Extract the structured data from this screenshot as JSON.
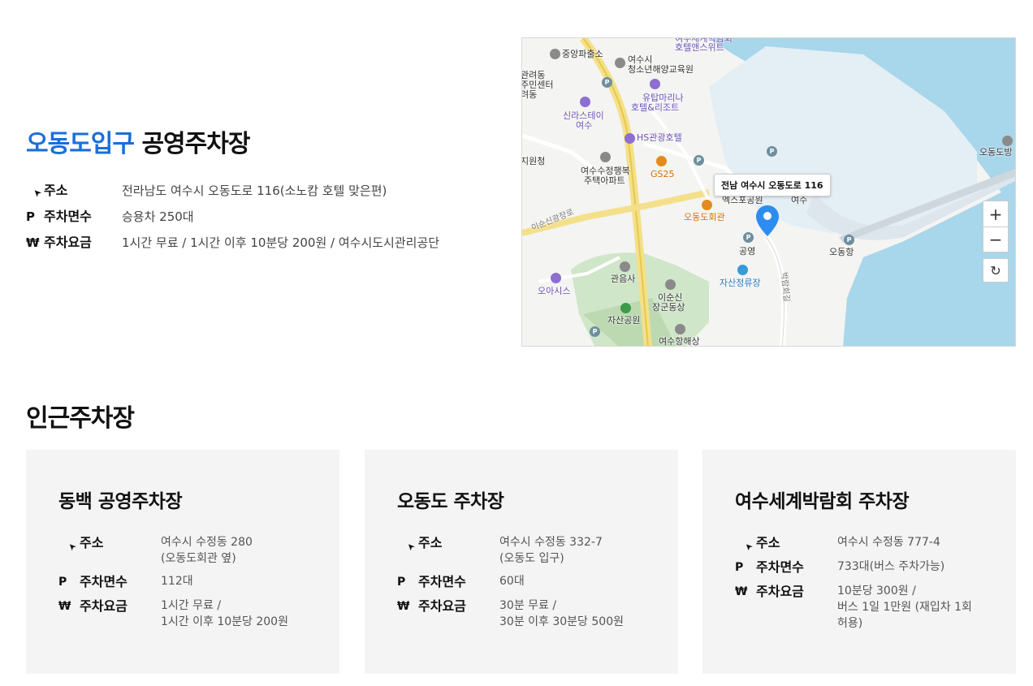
{
  "main": {
    "title_accent": "오동도입구",
    "title_rest": "공영주차장",
    "info": [
      {
        "icon": "navigation-arrow-icon",
        "glyph": "➤",
        "label": "주소",
        "value": "전라남도 여수시 오동도로 116(소노캄 호텔 맞은편)"
      },
      {
        "icon": "parking-icon",
        "glyph": "P",
        "label": "주차면수",
        "value": "승용차 250대"
      },
      {
        "icon": "won-icon",
        "glyph": "₩",
        "label": "주차요금",
        "value": "1시간 무료 / 1시간 이후 10분당 200원 / 여수시도시관리공단"
      }
    ]
  },
  "map": {
    "address_bubble": "전남 여수시 오동도로 116",
    "zoom_in": "+",
    "zoom_out": "−",
    "reset": "↻",
    "labels": {
      "police": "중앙파출소",
      "youth1": "여수시",
      "youth2": "청소년해양교육원",
      "hotel_top1": "여수세계박람회",
      "hotel_top2": "호텔앤스위트",
      "gwanmun1": "관려동",
      "gwanmun2": "주민센터",
      "gwanmun3": "려동",
      "utop1": "유탑마리나",
      "utop2": "호텔&리조트",
      "shilla1": "신라스테이",
      "shilla2": "여수",
      "hs": "HS관광호텔",
      "odongdo_bang": "오동도방",
      "jiwon": "지원청",
      "apt1": "여수수정행복",
      "apt2": "주택아파트",
      "gs25": "GS25",
      "expo": "엑스포공원",
      "yeosu": "여수",
      "odong_hall": "오동도회관",
      "road1": "이순신광장로",
      "public": "공영",
      "odong_port": "오동항",
      "jasan_station": "자산정류장",
      "gwaneum": "관음사",
      "oasis": "오아시스",
      "yisunsin1": "이순신",
      "yisunsin2": "장군동상",
      "jasan_park": "자산공원",
      "haesang": "여수항해상",
      "road2": "박람회길"
    }
  },
  "nearby": {
    "title": "인근주차장",
    "cards": [
      {
        "name": "동백 공영주차장",
        "rows": [
          {
            "icon": "navigation-arrow-icon",
            "glyph": "➤",
            "label": "주소",
            "value": "여수시 수정동 280\n(오동도회관 옆)"
          },
          {
            "icon": "parking-icon",
            "glyph": "P",
            "label": "주차면수",
            "value": "112대"
          },
          {
            "icon": "won-icon",
            "glyph": "₩",
            "label": "주차요금",
            "value": "1시간 무료 /\n1시간 이후 10분당 200원"
          }
        ]
      },
      {
        "name": "오동도 주차장",
        "rows": [
          {
            "icon": "navigation-arrow-icon",
            "glyph": "➤",
            "label": "주소",
            "value": "여수시 수정동 332-7\n(오동도 입구)"
          },
          {
            "icon": "parking-icon",
            "glyph": "P",
            "label": "주차면수",
            "value": "60대"
          },
          {
            "icon": "won-icon",
            "glyph": "₩",
            "label": "주차요금",
            "value": "30분 무료 /\n30분 이후 30분당 500원"
          }
        ]
      },
      {
        "name": "여수세계박람회 주차장",
        "rows": [
          {
            "icon": "navigation-arrow-icon",
            "glyph": "➤",
            "label": "주소",
            "value": "여수시 수정동 777-4"
          },
          {
            "icon": "parking-icon",
            "glyph": "P",
            "label": "주차면수",
            "value": "733대(버스 주차가능)"
          },
          {
            "icon": "won-icon",
            "glyph": "₩",
            "label": "주차요금",
            "value": "10분당 300원 /\n버스 1일 1만원 (재입차 1회\n허용)"
          }
        ]
      }
    ]
  }
}
